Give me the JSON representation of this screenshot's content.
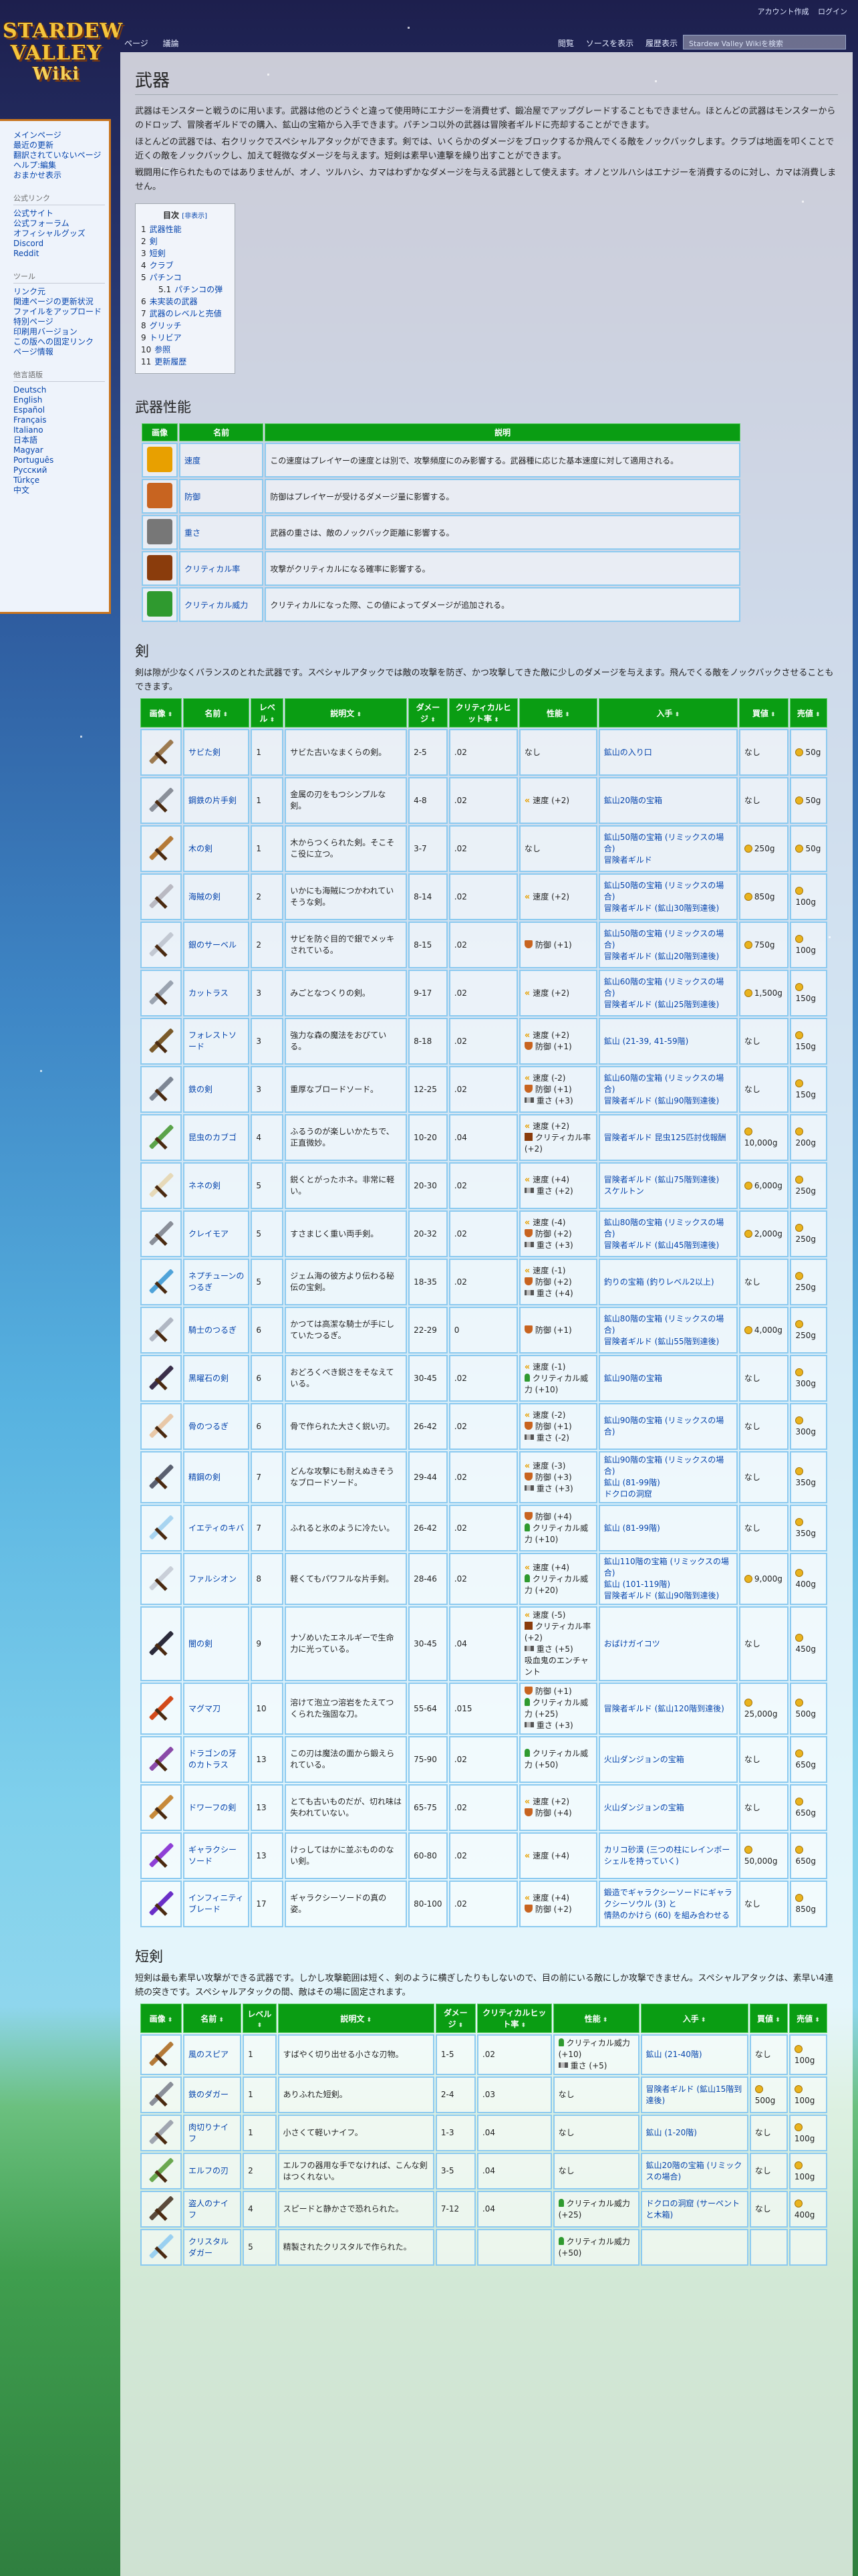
{
  "top_links": [
    "アカウント作成",
    "ログイン"
  ],
  "logo": {
    "line1": "STARDEW",
    "line2": "VALLEY",
    "line3": "Wiki"
  },
  "sidebar": {
    "main": [
      "メインページ",
      "最近の更新",
      "翻訳されていないページ",
      "ヘルプ:編集",
      "おまかせ表示"
    ],
    "official_head": "公式リンク",
    "official": [
      "公式サイト",
      "公式フォーラム",
      "オフィシャルグッズ",
      "Discord",
      "Reddit"
    ],
    "tools_head": "ツール",
    "tools": [
      "リンク元",
      "関連ページの更新状況",
      "ファイルをアップロード",
      "特別ページ",
      "印刷用バージョン",
      "この版への固定リンク",
      "ページ情報"
    ],
    "lang_head": "他言語版",
    "langs": [
      "Deutsch",
      "English",
      "Español",
      "Français",
      "Italiano",
      "日本語",
      "Magyar",
      "Português",
      "Русский",
      "Türkçe",
      "中文"
    ]
  },
  "tabs": {
    "page": "ページ",
    "talk": "議論",
    "read": "閲覧",
    "view_source": "ソースを表示",
    "history": "履歴表示",
    "search_placeholder": "Stardew Valley Wikiを検索"
  },
  "page_title": "武器",
  "intro": [
    "武器はモンスターと戦うのに用います。武器は他のどうぐと違って使用時にエナジーを消費せず、鍛冶屋でアップグレードすることもできません。ほとんどの武器はモンスターからのドロップ、冒険者ギルドでの購入、鉱山の宝箱から入手できます。パチンコ以外の武器は冒険者ギルドに売却することができます。",
    "ほとんどの武器では、右クリックでスペシャルアタックができます。剣では、いくらかのダメージをブロックするか飛んでくる敵をノックバックします。クラブは地面を叩くことで近くの敵をノックバックし、加えて軽微なダメージを与えます。短剣は素早い連撃を繰り出すことができます。",
    "戦闘用に作られたものではありませんが、オノ、ツルハシ、カマはわずかなダメージを与える武器として使えます。オノとツルハシはエナジーを消費するのに対し、カマは消費しません。"
  ],
  "toc": {
    "title": "目次",
    "toggle": "[非表示]",
    "items": [
      {
        "n": "1",
        "t": "武器性能"
      },
      {
        "n": "2",
        "t": "剣"
      },
      {
        "n": "3",
        "t": "短剣"
      },
      {
        "n": "4",
        "t": "クラブ"
      },
      {
        "n": "5",
        "t": "パチンコ"
      },
      {
        "n": "5.1",
        "t": "パチンコの弾",
        "sub": true
      },
      {
        "n": "6",
        "t": "未実装の武器"
      },
      {
        "n": "7",
        "t": "武器のレベルと売値"
      },
      {
        "n": "8",
        "t": "グリッチ"
      },
      {
        "n": "9",
        "t": "トリビア"
      },
      {
        "n": "10",
        "t": "参照"
      },
      {
        "n": "11",
        "t": "更新履歴"
      }
    ]
  },
  "stats_section": {
    "heading": "武器性能",
    "headers": [
      "画像",
      "名前",
      "説明"
    ],
    "rows": [
      {
        "icon": "speed-icon",
        "name": "速度",
        "desc": "この速度はプレイヤーの速度とは別で、攻撃頻度にのみ影響する。武器種に応じた基本速度に対して適用される。",
        "color": "#e8a000"
      },
      {
        "icon": "defense-icon",
        "name": "防御",
        "desc": "防御はプレイヤーが受けるダメージ量に影響する。",
        "color": "#c86420"
      },
      {
        "icon": "weight-icon",
        "name": "重さ",
        "desc": "武器の重さは、敵のノックバック距離に影響する。",
        "color": "#777777"
      },
      {
        "icon": "crit-chance-icon",
        "name": "クリティカル率",
        "desc": "攻撃がクリティカルになる確率に影響する。",
        "color": "#8a3c0c"
      },
      {
        "icon": "crit-power-icon",
        "name": "クリティカル威力",
        "desc": "クリティカルになった際、この値によってダメージが追加される。",
        "color": "#2f9a2f"
      }
    ]
  },
  "swords": {
    "heading": "剣",
    "intro": "剣は隙が少なくバランスのとれた武器です。スペシャルアタックでは敵の攻撃を防ぎ、かつ攻撃してきた敵に少しのダメージを与えます。飛んでくる敵をノックバックさせることもできます。",
    "headers": [
      "画像",
      "名前",
      "レベル",
      "説明文",
      "ダメージ",
      "クリティカルヒット率",
      "性能",
      "入手",
      "買値",
      "売値"
    ],
    "rows": [
      {
        "name": "サビた剣",
        "lv": "1",
        "desc": "サビた古いなまくらの剣。",
        "dmg": "2-5",
        "crit": ".02",
        "stats": [
          "なし"
        ],
        "src": [
          "鉱山の入り口"
        ],
        "buy": "なし",
        "sell": "50g",
        "col": "#9c7a50"
      },
      {
        "name": "鋼鉄の片手剣",
        "lv": "1",
        "desc": "金属の刃をもつシンプルな剣。",
        "dmg": "4-8",
        "crit": ".02",
        "stats": [
          "速度 (+2)"
        ],
        "src": [
          "鉱山20階の宝箱"
        ],
        "buy": "なし",
        "sell": "50g",
        "col": "#8a8f99"
      },
      {
        "name": "木の剣",
        "lv": "1",
        "desc": "木からつくられた剣。そこそこ役に立つ。",
        "dmg": "3-7",
        "crit": ".02",
        "stats": [
          "なし"
        ],
        "src": [
          "鉱山50階の宝箱 (リミックスの場合)",
          "冒険者ギルド"
        ],
        "buy": "250g",
        "sell": "50g",
        "col": "#b47a38"
      },
      {
        "name": "海賊の剣",
        "lv": "2",
        "desc": "いかにも海賊につかわれていそうな剣。",
        "dmg": "8-14",
        "crit": ".02",
        "stats": [
          "速度 (+2)"
        ],
        "src": [
          "鉱山50階の宝箱 (リミックスの場合)",
          "冒険者ギルド (鉱山30階到達後)"
        ],
        "buy": "850g",
        "sell": "100g",
        "col": "#b9b9c2"
      },
      {
        "name": "銀のサーベル",
        "lv": "2",
        "desc": "サビを防ぐ目的で銀でメッキされている。",
        "dmg": "8-15",
        "crit": ".02",
        "stats": [
          "防御 (+1)"
        ],
        "src": [
          "鉱山50階の宝箱 (リミックスの場合)",
          "冒険者ギルド (鉱山20階到達後)"
        ],
        "buy": "750g",
        "sell": "100g",
        "col": "#c2c8d2"
      },
      {
        "name": "カットラス",
        "lv": "3",
        "desc": "みごとなつくりの剣。",
        "dmg": "9-17",
        "crit": ".02",
        "stats": [
          "速度 (+2)"
        ],
        "src": [
          "鉱山60階の宝箱 (リミックスの場合)",
          "冒険者ギルド (鉱山25階到達後)"
        ],
        "buy": "1,500g",
        "sell": "150g",
        "col": "#9aa3b0"
      },
      {
        "name": "フォレストソード",
        "lv": "3",
        "desc": "強力な森の魔法をおびている。",
        "dmg": "8-18",
        "crit": ".02",
        "stats": [
          "速度 (+2)",
          "防御 (+1)"
        ],
        "src": [
          "鉱山 (21-39, 41-59階)"
        ],
        "buy": "なし",
        "sell": "150g",
        "col": "#7a5a2a"
      },
      {
        "name": "鉄の剣",
        "lv": "3",
        "desc": "重厚なブロードソード。",
        "dmg": "12-25",
        "crit": ".02",
        "stats": [
          "速度 (-2)",
          "防御 (+1)",
          "重さ (+3)"
        ],
        "src": [
          "鉱山60階の宝箱 (リミックスの場合)",
          "冒険者ギルド (鉱山90階到達後)"
        ],
        "buy": "なし",
        "sell": "150g",
        "col": "#7d8694"
      },
      {
        "name": "昆虫のカブゴ",
        "lv": "4",
        "desc": "ふるうのが楽しいかたちで、正直微妙。",
        "dmg": "10-20",
        "crit": ".04",
        "stats": [
          "速度 (+2)",
          "クリティカル率 (+2)"
        ],
        "src": [
          "冒険者ギルド 昆虫125匹討伐報酬"
        ],
        "buy": "10,000g",
        "sell": "200g",
        "col": "#5aa34a"
      },
      {
        "name": "ネネの剣",
        "lv": "5",
        "desc": "鋭くとがったホネ。非常に軽い。",
        "dmg": "20-30",
        "crit": ".02",
        "stats": [
          "速度 (+4)",
          "重さ (+2)"
        ],
        "src": [
          "冒険者ギルド (鉱山75階到達後)",
          "スケルトン"
        ],
        "buy": "6,000g",
        "sell": "250g",
        "col": "#e6d9b8"
      },
      {
        "name": "クレイモア",
        "lv": "5",
        "desc": "すさまじく重い両手剣。",
        "dmg": "20-32",
        "crit": ".02",
        "stats": [
          "速度 (-4)",
          "防御 (+2)",
          "重さ (+3)"
        ],
        "src": [
          "鉱山80階の宝箱 (リミックスの場合)",
          "冒険者ギルド (鉱山45階到達後)"
        ],
        "buy": "2,000g",
        "sell": "250g",
        "col": "#8a8f99"
      },
      {
        "name": "ネプチューンのつるぎ",
        "lv": "5",
        "desc": "ジェム海の彼方より伝わる秘伝の宝剣。",
        "dmg": "18-35",
        "crit": ".02",
        "stats": [
          "速度 (-1)",
          "防御 (+2)",
          "重さ (+4)"
        ],
        "src": [
          "釣りの宝箱 (釣りレベル2以上)"
        ],
        "buy": "なし",
        "sell": "250g",
        "col": "#4fa3d9"
      },
      {
        "name": "騎士のつるぎ",
        "lv": "6",
        "desc": "かつては高潔な騎士が手にしていたつるぎ。",
        "dmg": "22-29",
        "crit": "0",
        "stats": [
          "防御 (+1)"
        ],
        "src": [
          "鉱山80階の宝箱 (リミックスの場合)",
          "冒険者ギルド (鉱山55階到達後)"
        ],
        "buy": "4,000g",
        "sell": "250g",
        "col": "#b0b7c3"
      },
      {
        "name": "黒曜石の剣",
        "lv": "6",
        "desc": "おどろくべき鋭さをそなえている。",
        "dmg": "30-45",
        "crit": ".02",
        "stats": [
          "速度 (-1)",
          "クリティカル威力 (+10)"
        ],
        "src": [
          "鉱山90階の宝箱"
        ],
        "buy": "なし",
        "sell": "300g",
        "col": "#3a2f4a"
      },
      {
        "name": "骨のつるぎ",
        "lv": "6",
        "desc": "骨で作られた大さく鋭い刃。",
        "dmg": "26-42",
        "crit": ".02",
        "stats": [
          "速度 (-2)",
          "防御 (+1)",
          "重さ (-2)"
        ],
        "src": [
          "鉱山90階の宝箱 (リミックスの場合)"
        ],
        "buy": "なし",
        "sell": "300g",
        "col": "#e8c8a8"
      },
      {
        "name": "精鋼の剣",
        "lv": "7",
        "desc": "どんな攻撃にも耐えぬきそうなブロードソード。",
        "dmg": "29-44",
        "crit": ".02",
        "stats": [
          "速度 (-3)",
          "防御 (+3)",
          "重さ (+3)"
        ],
        "src": [
          "鉱山90階の宝箱 (リミックスの場合)",
          "鉱山 (81-99階)",
          "ドクロの洞窟"
        ],
        "buy": "なし",
        "sell": "350g",
        "col": "#5a6070"
      },
      {
        "name": "イエティのキバ",
        "lv": "7",
        "desc": "ふれると氷のように冷たい。",
        "dmg": "26-42",
        "crit": ".02",
        "stats": [
          "防御 (+4)",
          "クリティカル威力 (+10)"
        ],
        "src": [
          "鉱山 (81-99階)"
        ],
        "buy": "なし",
        "sell": "350g",
        "col": "#a8d4f0"
      },
      {
        "name": "ファルシオン",
        "lv": "8",
        "desc": "軽くてもパワフルな片手剣。",
        "dmg": "28-46",
        "crit": ".02",
        "stats": [
          "速度 (+4)",
          "クリティカル威力 (+20)"
        ],
        "src": [
          "鉱山110階の宝箱 (リミックスの場合)",
          "鉱山 (101-119階)",
          "冒険者ギルド (鉱山90階到達後)"
        ],
        "buy": "9,000g",
        "sell": "400g",
        "col": "#c9cfd8"
      },
      {
        "name": "闇の剣",
        "lv": "9",
        "desc": "ナゾめいたエネルギーで生命力に光っている。",
        "dmg": "30-45",
        "crit": ".04",
        "stats": [
          "速度 (-5)",
          "クリティカル率 (+2)",
          "重さ (+5)",
          "吸血鬼のエンチャント"
        ],
        "src": [
          "おばけガイコツ"
        ],
        "buy": "なし",
        "sell": "450g",
        "col": "#2b2b3b"
      },
      {
        "name": "マグマ刀",
        "lv": "10",
        "desc": "溶けて泡立つ溶岩をたえてつくられた強固な刀。",
        "dmg": "55-64",
        "crit": ".015",
        "stats": [
          "防御 (+1)",
          "クリティカル威力 (+25)",
          "重さ (+3)"
        ],
        "src": [
          "冒険者ギルド (鉱山120階到達後)"
        ],
        "buy": "25,000g",
        "sell": "500g",
        "col": "#d24a1a"
      },
      {
        "name": "ドラゴンの牙のカトラス",
        "lv": "13",
        "desc": "この刃は魔法の面から鍛えられている。",
        "dmg": "75-90",
        "crit": ".02",
        "stats": [
          "クリティカル威力 (+50)"
        ],
        "src": [
          "火山ダンジョンの宝箱"
        ],
        "buy": "なし",
        "sell": "650g",
        "col": "#8a4aa8"
      },
      {
        "name": "ドワーフの剣",
        "lv": "13",
        "desc": "とても古いものだが、切れ味は失われていない。",
        "dmg": "65-75",
        "crit": ".02",
        "stats": [
          "速度 (+2)",
          "防御 (+4)"
        ],
        "src": [
          "火山ダンジョンの宝箱"
        ],
        "buy": "なし",
        "sell": "650g",
        "col": "#c78a3a"
      },
      {
        "name": "ギャラクシーソード",
        "lv": "13",
        "desc": "けっしてはかに並ぶもののない剣。",
        "dmg": "60-80",
        "crit": ".02",
        "stats": [
          "速度 (+4)"
        ],
        "src": [
          "カリコ砂漠 (三つの柱にレインボーシェルを持っていく)"
        ],
        "buy": "50,000g",
        "sell": "650g",
        "col": "#8e3fd6"
      },
      {
        "name": "インフィニティブレード",
        "lv": "17",
        "desc": "ギャラクシーソードの真の姿。",
        "dmg": "80-100",
        "crit": ".02",
        "stats": [
          "速度 (+4)",
          "防御 (+2)"
        ],
        "src": [
          "鍛造でギャラクシーソードにギャラクシーソウル (3) と",
          "情熱のかけら (60) を組み合わせる"
        ],
        "buy": "なし",
        "sell": "850g",
        "col": "#6a2fc8"
      }
    ]
  },
  "daggers": {
    "heading": "短剣",
    "intro": "短剣は最も素早い攻撃ができる武器です。しかし攻撃範囲は短く、剣のように横ぎしたりもしないので、目の前にいる敵にしか攻撃できません。スペシャルアタックは、素早い4連続の突きです。スペシャルアタックの間、敵はその場に固定されます。",
    "headers": [
      "画像",
      "名前",
      "レベル",
      "説明文",
      "ダメージ",
      "クリティカルヒット率",
      "性能",
      "入手",
      "買値",
      "売値"
    ],
    "rows": [
      {
        "name": "風のスピア",
        "lv": "1",
        "desc": "すばやく切り出せる小さな刃物。",
        "dmg": "1-5",
        "crit": ".02",
        "stats": [
          "クリティカル威力 (+10)",
          "重さ (+5)"
        ],
        "src": [
          "鉱山 (21-40階)"
        ],
        "buy": "なし",
        "sell": "100g",
        "col": "#b47a38"
      },
      {
        "name": "鉄のダガー",
        "lv": "1",
        "desc": "ありふれた短剣。",
        "dmg": "2-4",
        "crit": ".03",
        "stats": [
          "なし"
        ],
        "src": [
          "冒険者ギルド (鉱山15階到達後)"
        ],
        "buy": "500g",
        "sell": "100g",
        "col": "#8a8f99"
      },
      {
        "name": "肉切りナイフ",
        "lv": "1",
        "desc": "小さくて軽いナイフ。",
        "dmg": "1-3",
        "crit": ".04",
        "stats": [
          "なし"
        ],
        "src": [
          "鉱山 (1-20階)"
        ],
        "buy": "なし",
        "sell": "100g",
        "col": "#a0a6b0"
      },
      {
        "name": "エルフの刃",
        "lv": "2",
        "desc": "エルフの器用な手でなければ、こんな剣はつくれない。",
        "dmg": "3-5",
        "crit": ".04",
        "stats": [
          "なし"
        ],
        "src": [
          "鉱山20階の宝箱 (リミックスの場合)"
        ],
        "buy": "なし",
        "sell": "100g",
        "col": "#6aa84f"
      },
      {
        "name": "盗人のナイフ",
        "lv": "4",
        "desc": "スピードと静かさで恐れられた。",
        "dmg": "7-12",
        "crit": ".04",
        "stats": [
          "クリティカル威力 (+25)"
        ],
        "src": [
          "ドクロの洞窟 (サーペントと木箱)"
        ],
        "buy": "なし",
        "sell": "400g",
        "col": "#5a4a3a"
      },
      {
        "name": "クリスタルダガー",
        "lv": "5",
        "desc": "精製されたクリスタルで作られた。",
        "dmg": "",
        "crit": "",
        "stats": [
          "クリティカル威力 (+50)"
        ],
        "src": [
          ""
        ],
        "buy": "",
        "sell": "",
        "col": "#9ad0f0"
      }
    ]
  }
}
